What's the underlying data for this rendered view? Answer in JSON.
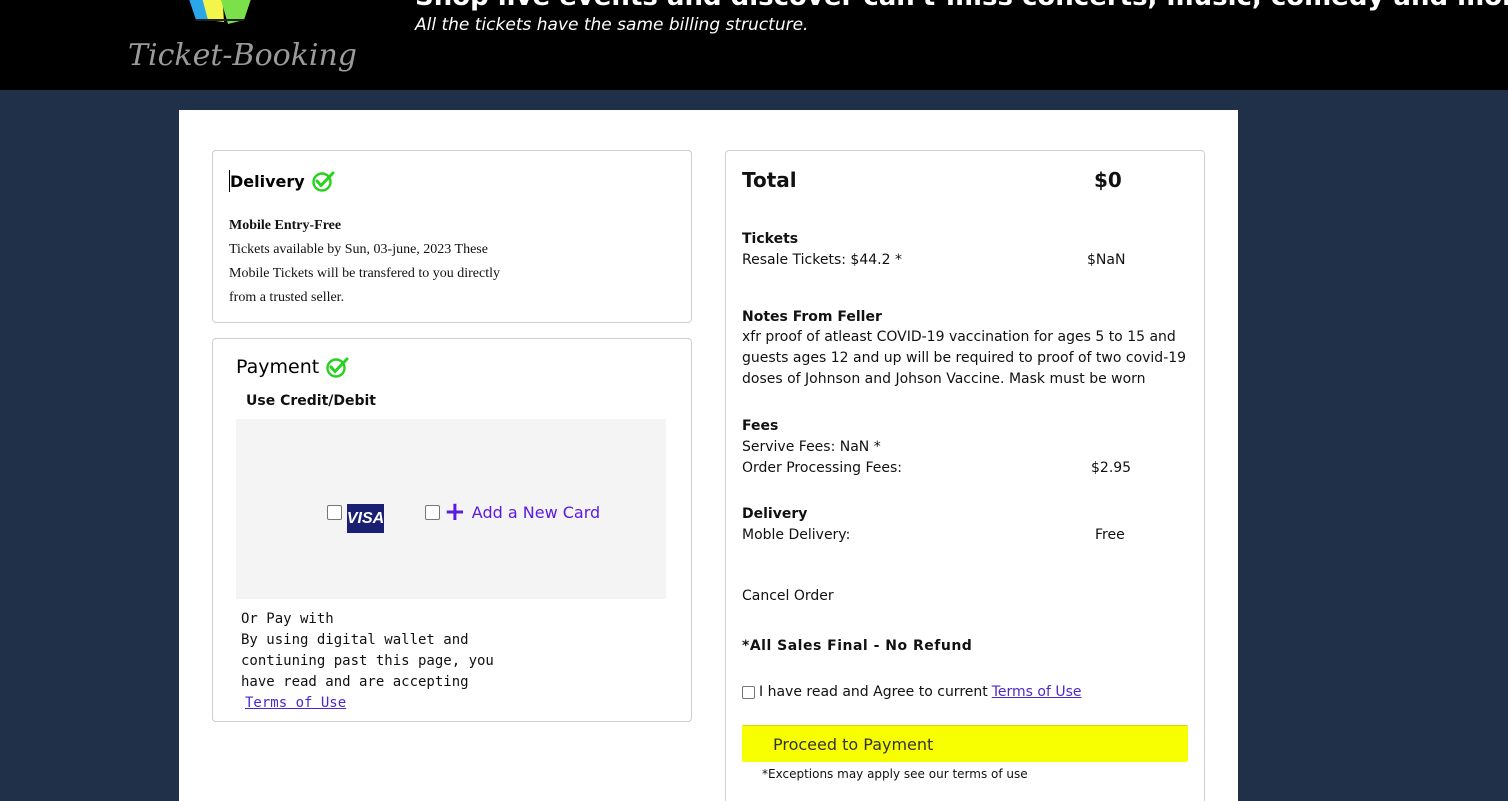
{
  "header": {
    "logo_text": "Ticket-Booking",
    "headline": "Shop live events and discover can't-miss concerts, music, comedy and more.",
    "subline": "All the tickets have the same billing structure."
  },
  "delivery": {
    "title": "Delivery",
    "option_title": "Mobile Entry-Free",
    "description": "Tickets available by Sun, 03-june, 2023 These Mobile Tickets will be transfered to you directly from a trusted seller."
  },
  "payment": {
    "title": "Payment",
    "use_credit": "Use Credit/Debit",
    "visa_label": "VISA",
    "add_card_label": "Add a New Card",
    "add_card_symbol": "+",
    "or_pay": "Or Pay with",
    "wallet_text": "By using digital wallet and contiuning past this page, you have read and are accepting",
    "terms_link": "Terms of Use"
  },
  "summary": {
    "total_label": "Total",
    "total_value": "$0",
    "tickets_heading": "Tickets",
    "resale_label": "Resale Tickets: $44.2 *",
    "resale_value": "$NaN",
    "notes_heading": "Notes From Feller",
    "notes_text": "xfr proof of atleast COVID-19 vaccination for ages 5 to 15 and guests ages 12 and up will be required to proof of two covid-19 doses of Johnson and Johson Vaccine. Mask must be worn",
    "fees_heading": "Fees",
    "service_fee_label": "Servive Fees: NaN *",
    "processing_label": "Order Processing Fees:",
    "processing_value": "$2.95",
    "delivery_heading": "Delivery",
    "mobile_delivery_label": "Moble Delivery:",
    "mobile_delivery_value": "Free",
    "cancel_order": "Cancel Order",
    "final_sale": "*All Sales Final - No Refund",
    "agree_text": "I have read and Agree to current",
    "agree_link": "Terms of Use",
    "proceed_label": "Proceed to Payment",
    "exceptions": "*Exceptions may apply see our terms of use"
  },
  "colors": {
    "background": "#213049",
    "header": "#000000",
    "accent_link": "#4d28c9",
    "check_green": "#27d21e",
    "proceed_button": "#f7ff00",
    "visa_blue": "#1a1f71"
  },
  "icons": [
    "logo-mark-icon",
    "check-circle-icon",
    "visa-icon",
    "plus-icon"
  ]
}
